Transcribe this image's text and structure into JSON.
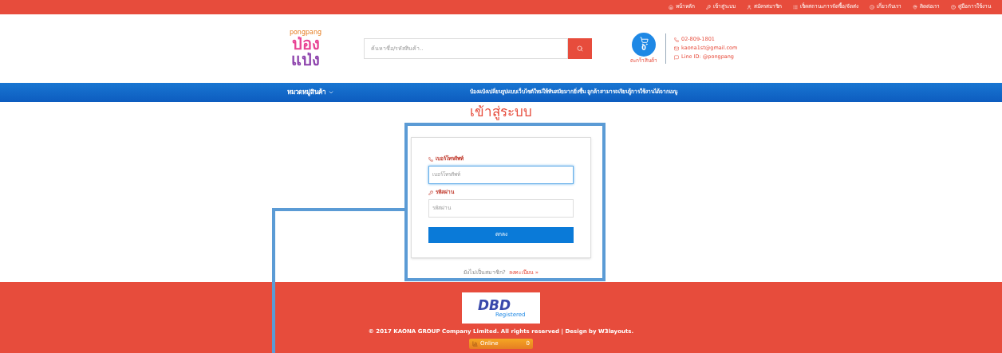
{
  "top_menu": [
    {
      "kind": "home",
      "label": "หน้าหลัก"
    },
    {
      "kind": "key",
      "label": "เข้าสู่ระบบ"
    },
    {
      "kind": "user",
      "label": "สมัครสมาชิก"
    },
    {
      "kind": "list",
      "label": "เช็คสถานะการจัดซื้อ/จัดส่ง"
    },
    {
      "kind": "info",
      "label": "เกี่ยวกับเรา"
    },
    {
      "kind": "pin",
      "label": "ติดต่อเรา"
    },
    {
      "kind": "help",
      "label": "คู่มือการใช้งาน"
    }
  ],
  "header": {
    "logo": {
      "small": "pongpang",
      "line1": "ป่อง",
      "line2": "แป่ง"
    },
    "search": {
      "placeholder": "ค้นหาชื่อ/รหัสสินค้า.."
    },
    "cart": {
      "count": "0",
      "label": "ตะกร้าสินค้า"
    },
    "contacts": [
      {
        "kind": "phone",
        "text": "02-809-1801"
      },
      {
        "kind": "mail",
        "text": "kaona1st@gmail.com"
      },
      {
        "kind": "line",
        "text": "Line ID: @pongpang"
      }
    ]
  },
  "nav": {
    "categories": "หมวดหมู่สินค้า",
    "notice": "ป๋องแป๋งเปลี่ยนรูปแบบเว็บไซต์ใหม่ให้ทันสมัยมากยิ่งขึ้น ลูกค้าสามารถเรียนรู้การใช้งานได้จากเมนู"
  },
  "login": {
    "title": "เข้าสู่ระบบ",
    "fields": [
      {
        "kind": "phone",
        "label": "เบอร์โทรศัพท์",
        "placeholder": "เบอร์โทรศัพท์",
        "focused": true
      },
      {
        "kind": "key",
        "label": "รหัสผ่าน",
        "placeholder": "รหัสผ่าน",
        "focused": false
      }
    ],
    "submit": "ตกลง",
    "register_prompt": "ยังไม่เป็นสมาชิก?",
    "register_link": "ลงทะเบียน »"
  },
  "footer": {
    "badge": {
      "mark": "DBD",
      "sub": "Registered"
    },
    "copyright": "© 2017 KAONA GROUP Company Limited. All rights reserved | Design by W3layouts.",
    "online": {
      "label": "Online",
      "count": "0"
    }
  }
}
